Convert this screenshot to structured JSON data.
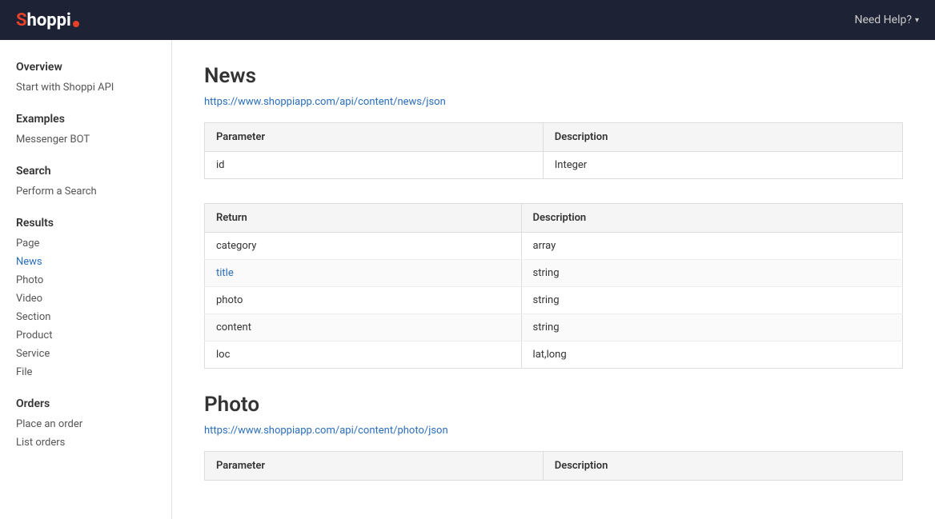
{
  "header": {
    "logo_text": "hoppi",
    "help_label": "Need Help?"
  },
  "sidebar": {
    "groups": [
      {
        "title": "Overview",
        "items": [
          {
            "label": "Start with Shoppi API",
            "active": false
          }
        ]
      },
      {
        "title": "Examples",
        "items": [
          {
            "label": "Messenger BOT",
            "active": false
          }
        ]
      },
      {
        "title": "Search",
        "items": [
          {
            "label": "Perform a Search",
            "active": false
          }
        ]
      },
      {
        "title": "Results",
        "items": [
          {
            "label": "Page",
            "active": false
          },
          {
            "label": "News",
            "active": true
          },
          {
            "label": "Photo",
            "active": false
          },
          {
            "label": "Video",
            "active": false
          },
          {
            "label": "Section",
            "active": false
          },
          {
            "label": "Product",
            "active": false
          },
          {
            "label": "Service",
            "active": false
          },
          {
            "label": "File",
            "active": false
          }
        ]
      },
      {
        "title": "Orders",
        "items": [
          {
            "label": "Place an order",
            "active": false
          },
          {
            "label": "List orders",
            "active": false
          }
        ]
      }
    ]
  },
  "main": {
    "sections": [
      {
        "id": "news",
        "heading": "News",
        "api_url": "https://www.shoppiapp.com/api/content/news/json",
        "param_table": {
          "columns": [
            "Parameter",
            "Description"
          ],
          "rows": [
            [
              "id",
              "Integer"
            ]
          ]
        },
        "return_table": {
          "columns": [
            "Return",
            "Description"
          ],
          "rows": [
            [
              "category",
              "array"
            ],
            [
              "title",
              "string",
              true
            ],
            [
              "photo",
              "string"
            ],
            [
              "content",
              "string"
            ],
            [
              "loc",
              "lat,long"
            ]
          ]
        }
      },
      {
        "id": "photo",
        "heading": "Photo",
        "api_url": "https://www.shoppiapp.com/api/content/photo/json",
        "param_table": {
          "columns": [
            "Parameter",
            "Description"
          ],
          "rows": []
        }
      }
    ]
  }
}
